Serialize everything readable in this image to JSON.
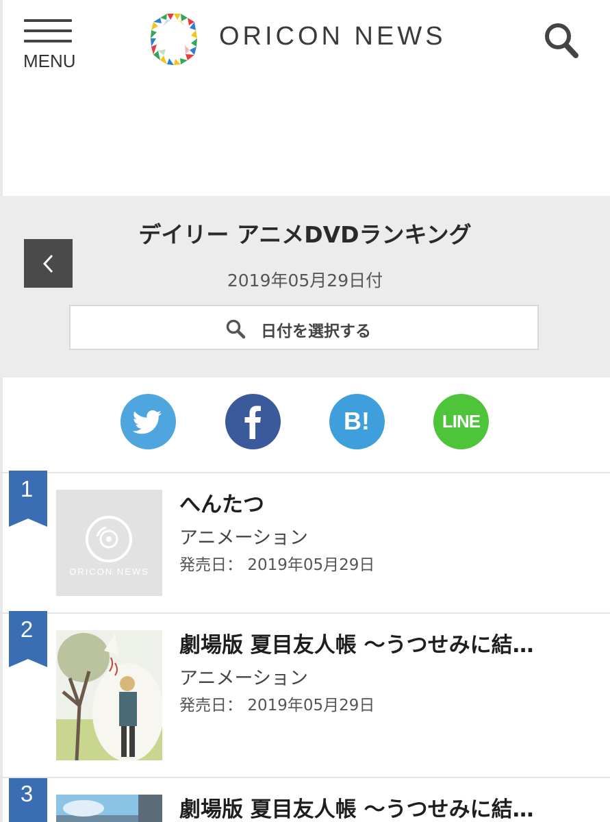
{
  "header": {
    "menu_label": "MENU",
    "logo_text": "ORICON NEWS"
  },
  "ranking": {
    "title": "デイリー アニメDVDランキング",
    "date": "2019年05月29日付",
    "select_date_label": "日付を選択する"
  },
  "share": {
    "line_label": "LINE",
    "colors": {
      "twitter": "#4fa5dd",
      "facebook": "#3b5a9b",
      "hatena": "#3f9fdc",
      "line": "#4ec43a"
    }
  },
  "items": [
    {
      "rank": "1",
      "title": "へんたつ",
      "genre": "アニメーション",
      "release_label": "発売日：",
      "release_date": "2019年05月29日",
      "thumb_watermark": "ORICON NEWS"
    },
    {
      "rank": "2",
      "title": "劇場版 夏目友人帳 〜うつせみに結…",
      "genre": "アニメーション",
      "release_label": "発売日：",
      "release_date": "2019年05月29日"
    },
    {
      "rank": "3",
      "title": "劇場版 夏目友人帳 〜うつせみに結…"
    }
  ],
  "accent_color": "#3a6db3"
}
